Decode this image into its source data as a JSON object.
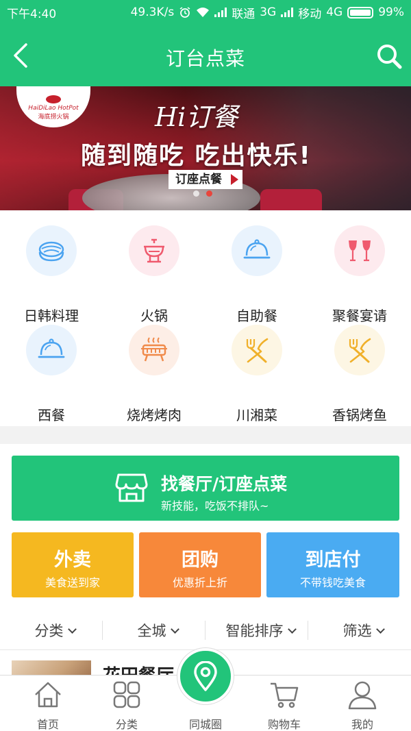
{
  "status_bar": {
    "time": "下午4:40",
    "speed": "49.3K/s",
    "carrier1": "联通",
    "net1": "3G",
    "carrier2": "移动",
    "net2": "4G",
    "battery": "99%"
  },
  "header": {
    "title": "订台点菜",
    "icons": [
      "back-arrow-icon",
      "search-icon"
    ]
  },
  "banner": {
    "brand_latin": "HaiDiLao HotPot",
    "brand_cn": "海底捞火锅",
    "headline_1": "Hi订餐",
    "headline_2": "随到随吃 吃出快乐!",
    "button_label": "订座点餐",
    "page_count": 2,
    "active_page": 2
  },
  "categories": [
    {
      "label": "日韩料理",
      "icon": "sushi-icon",
      "bg": "#e9f3fd",
      "color": "#4aa3f0"
    },
    {
      "label": "火锅",
      "icon": "hotpot-icon",
      "bg": "#fdeaee",
      "color": "#ef5a6e"
    },
    {
      "label": "自助餐",
      "icon": "food-cloche-icon",
      "bg": "#e9f3fd",
      "color": "#4aa3f0"
    },
    {
      "label": "聚餐宴请",
      "icon": "wine-glasses-icon",
      "bg": "#fdeaee",
      "color": "#ef5a6e"
    },
    {
      "label": "西餐",
      "icon": "food-cloche-icon",
      "bg": "#e9f3fd",
      "color": "#4aa3f0"
    },
    {
      "label": "烧烤烤肉",
      "icon": "grill-icon",
      "bg": "#fdeee6",
      "color": "#f08a4a"
    },
    {
      "label": "川湘菜",
      "icon": "fork-knife-icon",
      "bg": "#fdf6e4",
      "color": "#f0b02a"
    },
    {
      "label": "香锅烤鱼",
      "icon": "fork-knife-icon",
      "bg": "#fdf6e4",
      "color": "#f0b02a"
    }
  ],
  "find_restaurant": {
    "title": "找餐厅/订座点菜",
    "subtitle": "新技能，吃饭不排队~",
    "color": "#22c47a"
  },
  "service_tiles": [
    {
      "title": "外卖",
      "subtitle": "美食送到家",
      "color": "#f5b820"
    },
    {
      "title": "团购",
      "subtitle": "优惠折上折",
      "color": "#f7883a"
    },
    {
      "title": "到店付",
      "subtitle": "不带钱吃美食",
      "color": "#4aabf2"
    }
  ],
  "filters": [
    {
      "label": "分类",
      "active": true
    },
    {
      "label": "全城",
      "active": false
    },
    {
      "label": "智能排序",
      "active": false
    },
    {
      "label": "筛选",
      "active": false
    }
  ],
  "restaurant_preview": {
    "name": "花田餐厅"
  },
  "tabbar": [
    {
      "label": "首页",
      "icon": "home-icon"
    },
    {
      "label": "分类",
      "icon": "grid-icon"
    },
    {
      "label": "同城圈",
      "icon": "location-pin-icon"
    },
    {
      "label": "购物车",
      "icon": "cart-icon"
    },
    {
      "label": "我的",
      "icon": "user-icon"
    }
  ],
  "colors": {
    "brand": "#22c47a",
    "active_filter": "#22c47a"
  }
}
